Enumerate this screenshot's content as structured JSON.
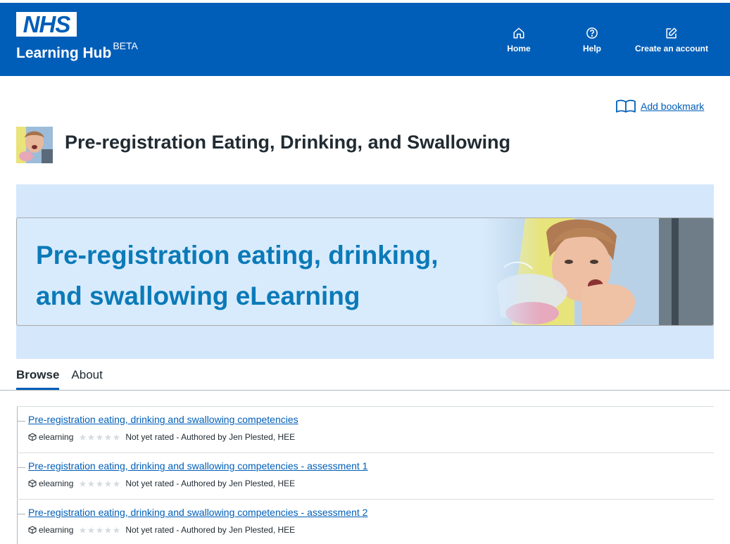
{
  "header": {
    "logo_text": "NHS",
    "hub_title": "Learning Hub",
    "beta": "BETA",
    "nav": [
      {
        "label": "Home",
        "icon": "home-icon"
      },
      {
        "label": "Help",
        "icon": "help-icon"
      },
      {
        "label": "Create an account",
        "icon": "edit-icon"
      }
    ]
  },
  "bookmark": {
    "label": "Add bookmark",
    "icon": "book-icon"
  },
  "catalogue": {
    "title": "Pre-registration Eating, Drinking, and Swallowing",
    "banner_line1": "Pre-registration eating, drinking,",
    "banner_line2": "and swallowing eLearning"
  },
  "tabs": [
    {
      "label": "Browse",
      "active": true
    },
    {
      "label": "About",
      "active": false
    }
  ],
  "resources": [
    {
      "title": "Pre-registration eating, drinking and swallowing competencies",
      "type": "elearning",
      "rating": "Not yet rated",
      "author": "- Authored by Jen Plested, HEE",
      "stars": 0
    },
    {
      "title": "Pre-registration eating, drinking and swallowing competencies - assessment 1",
      "type": "elearning",
      "rating": "Not yet rated",
      "author": "- Authored by Jen Plested, HEE",
      "stars": 0
    },
    {
      "title": "Pre-registration eating, drinking and swallowing competencies - assessment 2",
      "type": "elearning",
      "rating": "Not yet rated",
      "author": "- Authored by Jen Plested, HEE",
      "stars": 0
    }
  ],
  "colors": {
    "brand": "#005eb8",
    "banner_text": "#0b7ab8",
    "banner_bg": "#d5e7fb"
  }
}
